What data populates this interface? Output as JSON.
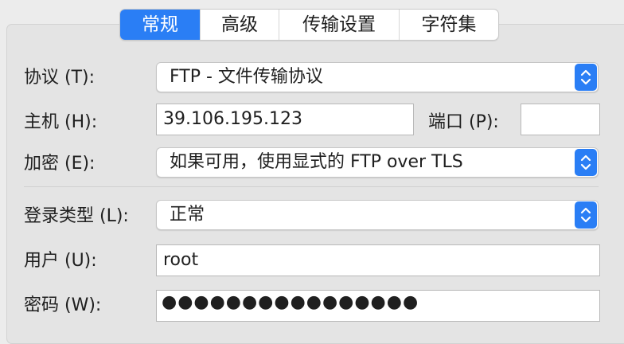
{
  "tabs": [
    {
      "label": "常规",
      "active": true
    },
    {
      "label": "高级",
      "active": false
    },
    {
      "label": "传输设置",
      "active": false
    },
    {
      "label": "字符集",
      "active": false
    }
  ],
  "form": {
    "protocol": {
      "label": "协议 (T):",
      "value": "FTP - 文件传输协议"
    },
    "host": {
      "label": "主机 (H):",
      "value": "39.106.195.123"
    },
    "port": {
      "label": "端口 (P):",
      "value": ""
    },
    "encryption": {
      "label": "加密 (E):",
      "value": "如果可用，使用显式的 FTP over TLS"
    },
    "logon_type": {
      "label": "登录类型 (L):",
      "value": "正常"
    },
    "user": {
      "label": "用户 (U):",
      "value": "root"
    },
    "password": {
      "label": "密码 (W):",
      "masked_value": "●●●●●●●●●●●●●●●●"
    }
  },
  "colors": {
    "accent": "#2a7ef5",
    "background": "#ececec"
  },
  "icons": {
    "select_stepper": "chevron-up-down-icon"
  }
}
